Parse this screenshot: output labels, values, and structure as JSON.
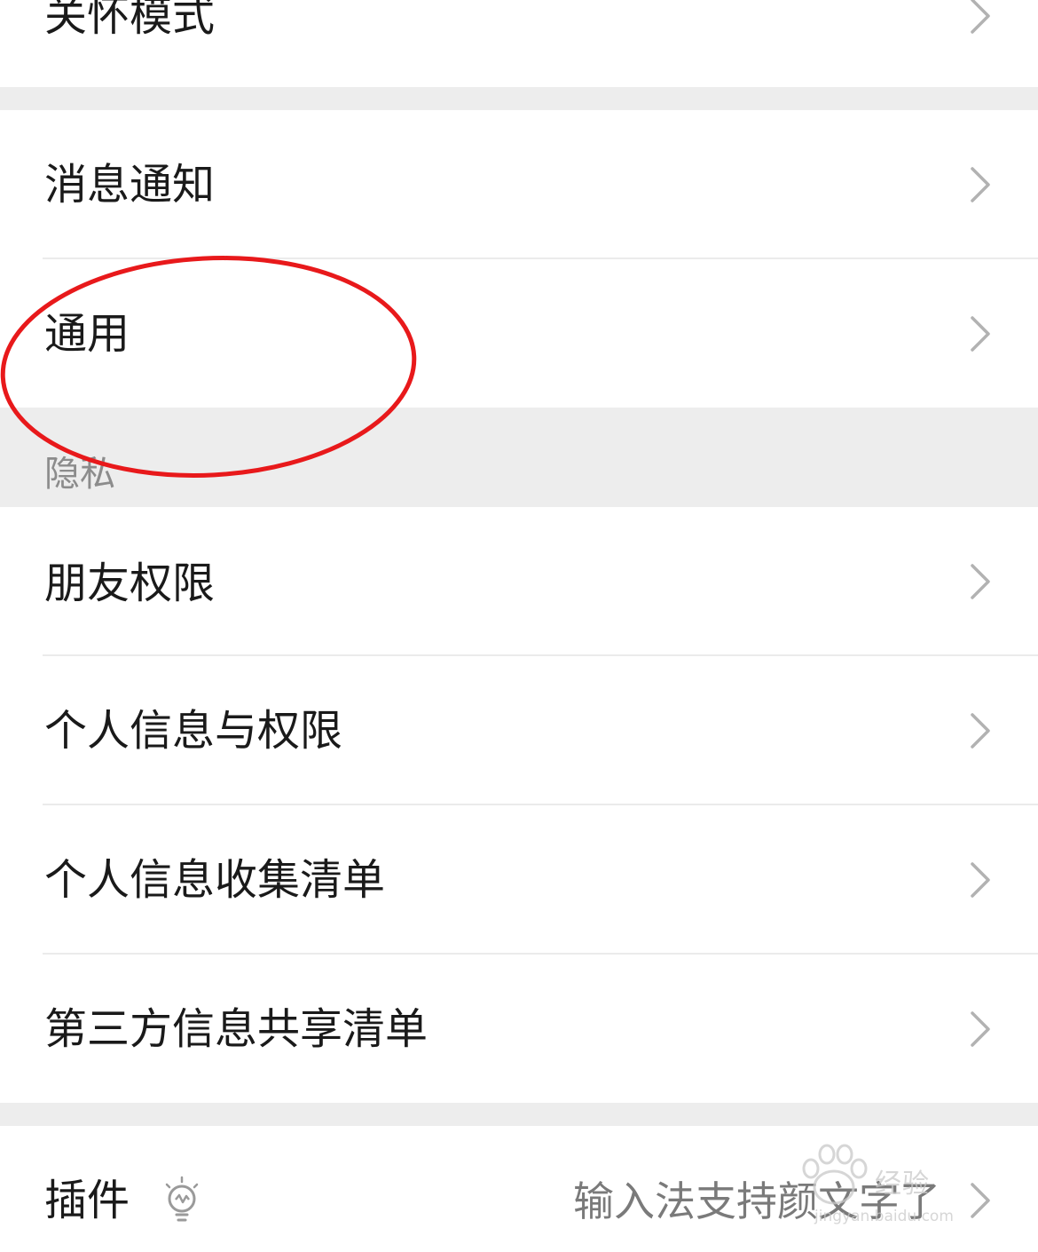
{
  "settings": {
    "rows": {
      "care_mode": "关怀模式",
      "notifications": "消息通知",
      "general": "通用",
      "friend_permissions": "朋友权限",
      "personal_info_permissions": "个人信息与权限",
      "personal_info_collection": "个人信息收集清单",
      "third_party_sharing": "第三方信息共享清单",
      "plugins": "插件"
    },
    "privacy_section_header": "隐私",
    "plugins_value": "输入法支持颜文字了"
  },
  "icons": {
    "chevron": "chevron-right-icon",
    "plugin": "lightbulb-icon"
  },
  "annotation": {
    "color": "#e8191b",
    "shape": "ellipse"
  },
  "watermark": {
    "text": "经验",
    "sub": "jingyan.baidu.com"
  },
  "colors": {
    "background": "#ffffff",
    "section_gap": "#ededed",
    "text_primary": "#1a1a1a",
    "text_secondary": "#8c8c8c",
    "chevron": "#b2b2b2"
  }
}
